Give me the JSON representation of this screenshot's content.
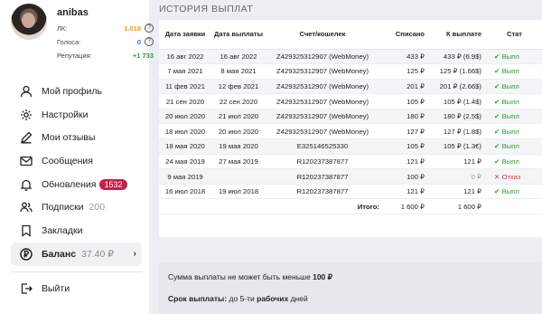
{
  "profile": {
    "username": "anibas",
    "stats": [
      {
        "label": "ЛК:",
        "value": "1.018",
        "color": "#e0a000"
      },
      {
        "label": "Голоса:",
        "value": "0",
        "color": "#2a7be4"
      },
      {
        "label": "Репутация:",
        "value": "+1 733",
        "color": "#2c9b3a"
      }
    ]
  },
  "menu": [
    {
      "label": "Мой профиль",
      "icon": "user-icon"
    },
    {
      "label": "Настройки",
      "icon": "gear-icon"
    },
    {
      "label": "Мои отзывы",
      "icon": "pencil-icon"
    },
    {
      "label": "Сообщения",
      "icon": "envelope-icon"
    },
    {
      "label": "Обновления",
      "icon": "bell-icon",
      "badge": "1532"
    },
    {
      "label": "Подписки",
      "icon": "users-icon",
      "count": "200"
    },
    {
      "label": "Закладки",
      "icon": "bookmark-icon"
    },
    {
      "label": "Баланс",
      "icon": "ruble-coin-icon",
      "count": "37.40 ₽"
    },
    {
      "label": "Выйти",
      "icon": "logout-icon"
    }
  ],
  "page": {
    "title": "ИСТОРИЯ ВЫПЛАТ"
  },
  "table": {
    "headers": [
      "Дата заявки",
      "Дата выплаты",
      "Счет/кошелек",
      "Списано",
      "К выплате",
      "Стат"
    ],
    "rows": [
      {
        "req": "16 авг 2022",
        "paid": "16 авг 2022",
        "account": "Z429325312907 (WebMoney)",
        "debited": "433 ₽",
        "payout": "433 ₽ (6.9$)",
        "status": "Выпл",
        "ok": true
      },
      {
        "req": "7 мая 2021",
        "paid": "8 мая 2021",
        "account": "Z429325312907 (WebMoney)",
        "debited": "125 ₽",
        "payout": "125 ₽ (1.66$)",
        "status": "Выпл",
        "ok": true
      },
      {
        "req": "11 фев 2021",
        "paid": "12 фев 2021",
        "account": "Z429325312907 (WebMoney)",
        "debited": "201 ₽",
        "payout": "201 ₽ (2.66$)",
        "status": "Выпл",
        "ok": true
      },
      {
        "req": "21 сен 2020",
        "paid": "22 сен 2020",
        "account": "Z429325312907 (WebMoney)",
        "debited": "105 ₽",
        "payout": "105 ₽ (1.4$)",
        "status": "Выпл",
        "ok": true
      },
      {
        "req": "20 июл 2020",
        "paid": "21 июл 2020",
        "account": "Z429325312907 (WebMoney)",
        "debited": "180 ₽",
        "payout": "180 ₽ (2.5$)",
        "status": "Выпл",
        "ok": true
      },
      {
        "req": "18 июл 2020",
        "paid": "20 июл 2020",
        "account": "Z429325312907 (WebMoney)",
        "debited": "127 ₽",
        "payout": "127 ₽ (1.8$)",
        "status": "Выпл",
        "ok": true
      },
      {
        "req": "18 мая 2020",
        "paid": "19 мая 2020",
        "account": "E325146525330",
        "debited": "105 ₽",
        "payout": "105 ₽ (1.3€)",
        "status": "Выпл",
        "ok": true
      },
      {
        "req": "24 мая 2019",
        "paid": "27 мая 2019",
        "account": "R120237387877",
        "debited": "121 ₽",
        "payout": "121 ₽",
        "status": "Выпл",
        "ok": true
      },
      {
        "req": "9 мая 2019",
        "paid": "",
        "account": "R120237387877",
        "debited": "100 ₽",
        "payout": "0 ₽",
        "status": "Отказ",
        "ok": false
      },
      {
        "req": "16 июл 2018",
        "paid": "19 июл 2018",
        "account": "R120237387877",
        "debited": "121 ₽",
        "payout": "121 ₽",
        "status": "Выпл",
        "ok": true
      }
    ],
    "total_label": "Итого:",
    "total_debited": "1 600 ₽",
    "total_payout": "1 600 ₽"
  },
  "notice": {
    "min_prefix": "Сумма выплаты не может быть меньше",
    "min_amount": "100 ₽",
    "term_label": "Срок выплаты:",
    "term_prefix": "до 5-ти",
    "term_bold": "рабочих",
    "term_suffix": "дней"
  },
  "colors": {
    "accent_badge": "#c81e4a",
    "ok": "#2c9b3a",
    "fail": "#d8334a"
  }
}
